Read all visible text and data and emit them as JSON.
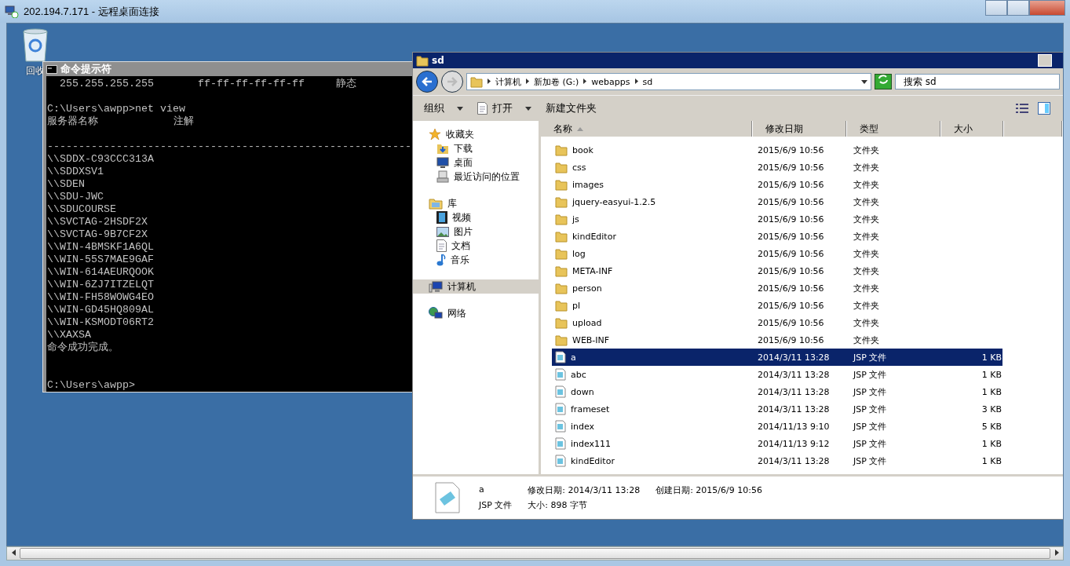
{
  "rdp_window": {
    "title": "202.194.7.171 - 远程桌面连接"
  },
  "desktop": {
    "icons": [
      {
        "label": "回收"
      }
    ]
  },
  "cmd_window": {
    "title": "命令提示符",
    "lines": [
      {
        "kind": "text",
        "text": "  255.255.255.255       ff-ff-ff-ff-ff-ff     静态"
      },
      {
        "kind": "blank"
      },
      {
        "kind": "text",
        "text": "C:\\Users\\awpp>net view"
      },
      {
        "kind": "text",
        "text": "服务器名称            注解"
      },
      {
        "kind": "blank"
      },
      {
        "kind": "text",
        "text": "----------------------------------------------------------"
      },
      {
        "kind": "text",
        "text": "\\\\SDDX-C93CCC313A"
      },
      {
        "kind": "text",
        "text": "\\\\SDDXSV1"
      },
      {
        "kind": "text",
        "text": "\\\\SDEN"
      },
      {
        "kind": "text",
        "text": "\\\\SDU-JWC"
      },
      {
        "kind": "text",
        "text": "\\\\SDUCOURSE"
      },
      {
        "kind": "text",
        "text": "\\\\SVCTAG-2HSDF2X"
      },
      {
        "kind": "text",
        "text": "\\\\SVCTAG-9B7CF2X"
      },
      {
        "kind": "text",
        "text": "\\\\WIN-4BMSKF1A6QL"
      },
      {
        "kind": "text",
        "text": "\\\\WIN-55S7MAE9GAF"
      },
      {
        "kind": "text",
        "text": "\\\\WIN-614AEURQOOK"
      },
      {
        "kind": "text",
        "text": "\\\\WIN-6ZJ7ITZELQT"
      },
      {
        "kind": "text",
        "text": "\\\\WIN-FH58WOWG4EO"
      },
      {
        "kind": "text",
        "text": "\\\\WIN-GD45HQ809AL"
      },
      {
        "kind": "text",
        "text": "\\\\WIN-KSMODT06RT2"
      },
      {
        "kind": "text",
        "text": "\\\\XAXSA"
      },
      {
        "kind": "text",
        "text": "命令成功完成。"
      },
      {
        "kind": "blank"
      },
      {
        "kind": "blank"
      },
      {
        "kind": "text",
        "text": "C:\\Users\\awpp>"
      }
    ]
  },
  "explorer": {
    "title": "sd",
    "breadcrumbs": [
      "计算机",
      "新加卷 (G:)",
      "webapps",
      "sd"
    ],
    "search": {
      "placeholder": "搜索 sd"
    },
    "toolbar": [
      {
        "label": "组织",
        "dropdown": true,
        "kind": "plain"
      },
      {
        "label": "打开",
        "dropdown": true,
        "kind": "open"
      },
      {
        "label": "新建文件夹",
        "dropdown": false,
        "kind": "plain"
      }
    ],
    "nav": [
      {
        "label": "收藏夹",
        "kind": "star",
        "selected": false,
        "children": [
          {
            "label": "下载",
            "kind": "download",
            "selected": false
          },
          {
            "label": "桌面",
            "kind": "desktop",
            "selected": false
          },
          {
            "label": "最近访问的位置",
            "kind": "recent",
            "selected": false
          }
        ]
      },
      {
        "label": "库",
        "kind": "library",
        "selected": false,
        "children": [
          {
            "label": "视频",
            "kind": "video",
            "selected": false
          },
          {
            "label": "图片",
            "kind": "picture",
            "selected": false
          },
          {
            "label": "文档",
            "kind": "document",
            "selected": false
          },
          {
            "label": "音乐",
            "kind": "music",
            "selected": false
          }
        ]
      },
      {
        "label": "计算机",
        "kind": "computer",
        "selected": true
      },
      {
        "label": "网络",
        "kind": "network",
        "selected": false
      }
    ],
    "columns": [
      {
        "label": "名称",
        "sorted": true
      },
      {
        "label": "修改日期",
        "sorted": false
      },
      {
        "label": "类型",
        "sorted": false
      },
      {
        "label": "大小",
        "sorted": false
      }
    ],
    "rows": [
      {
        "kind": "folder",
        "name": "book",
        "date": "2015/6/9 10:56",
        "type": "文件夹",
        "selected": false
      },
      {
        "kind": "folder",
        "name": "css",
        "date": "2015/6/9 10:56",
        "type": "文件夹",
        "selected": false
      },
      {
        "kind": "folder",
        "name": "images",
        "date": "2015/6/9 10:56",
        "type": "文件夹",
        "selected": false
      },
      {
        "kind": "folder",
        "name": "jquery-easyui-1.2.5",
        "date": "2015/6/9 10:56",
        "type": "文件夹",
        "selected": false
      },
      {
        "kind": "folder",
        "name": "js",
        "date": "2015/6/9 10:56",
        "type": "文件夹",
        "selected": false
      },
      {
        "kind": "folder",
        "name": "kindEditor",
        "date": "2015/6/9 10:56",
        "type": "文件夹",
        "selected": false
      },
      {
        "kind": "folder",
        "name": "log",
        "date": "2015/6/9 10:56",
        "type": "文件夹",
        "selected": false
      },
      {
        "kind": "folder",
        "name": "META-INF",
        "date": "2015/6/9 10:56",
        "type": "文件夹",
        "selected": false
      },
      {
        "kind": "folder",
        "name": "person",
        "date": "2015/6/9 10:56",
        "type": "文件夹",
        "selected": false
      },
      {
        "kind": "folder",
        "name": "pl",
        "date": "2015/6/9 10:56",
        "type": "文件夹",
        "selected": false
      },
      {
        "kind": "folder",
        "name": "upload",
        "date": "2015/6/9 10:56",
        "type": "文件夹",
        "selected": false
      },
      {
        "kind": "folder",
        "name": "WEB-INF",
        "date": "2015/6/9 10:56",
        "type": "文件夹",
        "selected": false
      },
      {
        "kind": "file",
        "name": "a",
        "date": "2014/3/11 13:28",
        "type": "JSP 文件",
        "size": "1 KB",
        "selected": true
      },
      {
        "kind": "file",
        "name": "abc",
        "date": "2014/3/11 13:28",
        "type": "JSP 文件",
        "size": "1 KB",
        "selected": false
      },
      {
        "kind": "file",
        "name": "down",
        "date": "2014/3/11 13:28",
        "type": "JSP 文件",
        "size": "1 KB",
        "selected": false
      },
      {
        "kind": "file",
        "name": "frameset",
        "date": "2014/3/11 13:28",
        "type": "JSP 文件",
        "size": "3 KB",
        "selected": false
      },
      {
        "kind": "file",
        "name": "index",
        "date": "2014/11/13 9:10",
        "type": "JSP 文件",
        "size": "5 KB",
        "selected": false
      },
      {
        "kind": "file",
        "name": "index111",
        "date": "2014/11/13 9:12",
        "type": "JSP 文件",
        "size": "1 KB",
        "selected": false
      },
      {
        "kind": "file",
        "name": "kindEditor",
        "date": "2014/3/11 13:28",
        "type": "JSP 文件",
        "size": "1 KB",
        "selected": false
      }
    ],
    "details": {
      "name": "a",
      "type": "JSP 文件",
      "modified": "修改日期: 2014/3/11 13:28",
      "created": "创建日期: 2015/6/9 10:56",
      "size": "大小: 898 字节"
    }
  }
}
